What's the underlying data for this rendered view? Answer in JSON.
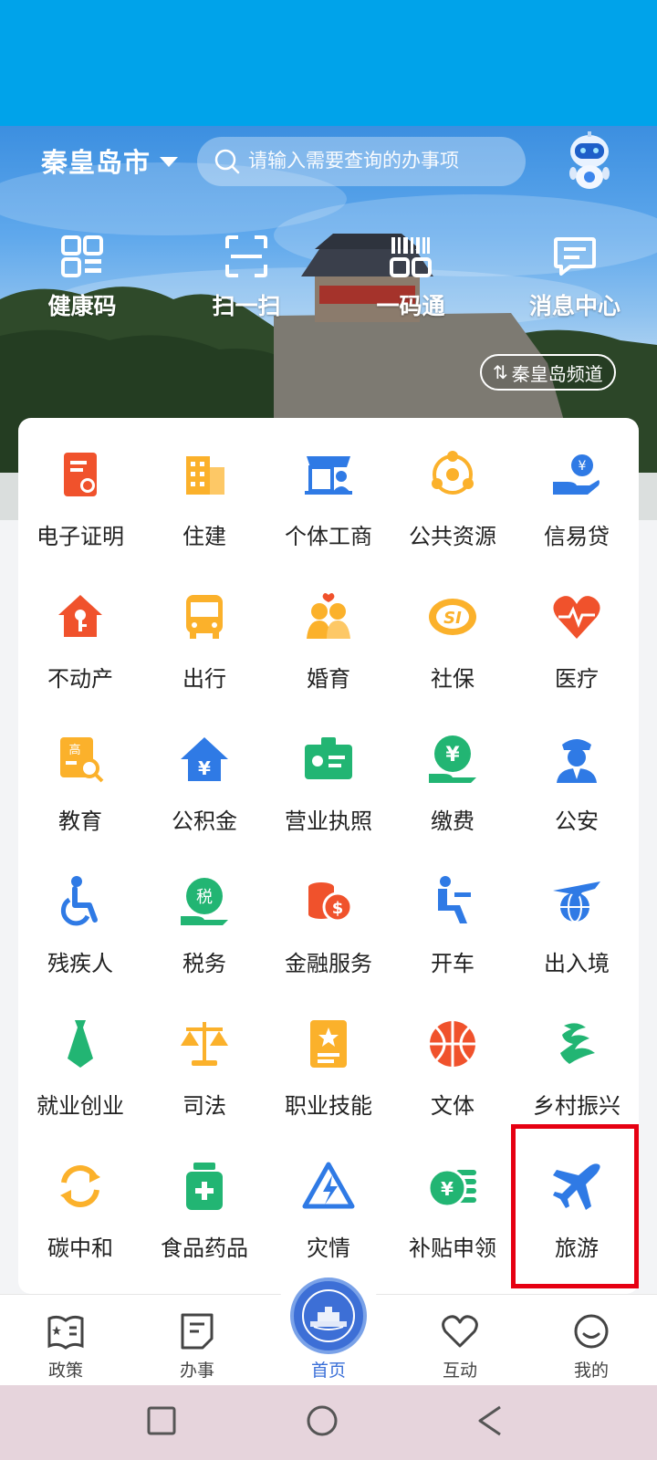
{
  "header": {
    "city": "秦皇岛市",
    "search_placeholder": "请输入需要查询的办事项",
    "channel_label": "秦皇岛频道"
  },
  "quick_actions": [
    {
      "label": "健康码",
      "icon": "qrcode-icon"
    },
    {
      "label": "扫一扫",
      "icon": "scan-icon"
    },
    {
      "label": "一码通",
      "icon": "barcode-icon"
    },
    {
      "label": "消息中心",
      "icon": "message-icon"
    }
  ],
  "services": [
    {
      "label": "电子证明",
      "icon": "certificate-icon",
      "color": "#f0522c"
    },
    {
      "label": "住建",
      "icon": "building-icon",
      "color": "#fbb12b"
    },
    {
      "label": "个体工商",
      "icon": "store-icon",
      "color": "#2f7ae5"
    },
    {
      "label": "公共资源",
      "icon": "resource-network-icon",
      "color": "#fbb12b"
    },
    {
      "label": "信易贷",
      "icon": "loan-hand-icon",
      "color": "#2f7ae5"
    },
    {
      "label": "不动产",
      "icon": "house-key-icon",
      "color": "#f0522c"
    },
    {
      "label": "出行",
      "icon": "bus-icon",
      "color": "#fbb12b"
    },
    {
      "label": "婚育",
      "icon": "couple-icon",
      "color": "#fbb12b"
    },
    {
      "label": "社保",
      "icon": "social-security-icon",
      "color": "#fbb12b"
    },
    {
      "label": "医疗",
      "icon": "heart-pulse-icon",
      "color": "#f0522c"
    },
    {
      "label": "教育",
      "icon": "education-icon",
      "color": "#fbb12b"
    },
    {
      "label": "公积金",
      "icon": "housing-fund-icon",
      "color": "#2f7ae5"
    },
    {
      "label": "营业执照",
      "icon": "business-license-icon",
      "color": "#22b573"
    },
    {
      "label": "缴费",
      "icon": "payment-icon",
      "color": "#22b573"
    },
    {
      "label": "公安",
      "icon": "police-icon",
      "color": "#2f7ae5"
    },
    {
      "label": "残疾人",
      "icon": "wheelchair-icon",
      "color": "#2f7ae5"
    },
    {
      "label": "税务",
      "icon": "tax-icon",
      "color": "#22b573"
    },
    {
      "label": "金融服务",
      "icon": "coins-icon",
      "color": "#f0522c"
    },
    {
      "label": "开车",
      "icon": "driver-seat-icon",
      "color": "#2f7ae5"
    },
    {
      "label": "出入境",
      "icon": "plane-globe-icon",
      "color": "#2f7ae5"
    },
    {
      "label": "就业创业",
      "icon": "tie-icon",
      "color": "#22b573"
    },
    {
      "label": "司法",
      "icon": "scales-icon",
      "color": "#fbb12b"
    },
    {
      "label": "职业技能",
      "icon": "skill-book-icon",
      "color": "#fbb12b"
    },
    {
      "label": "文体",
      "icon": "basketball-icon",
      "color": "#f0522c"
    },
    {
      "label": "乡村振兴",
      "icon": "rural-revival-icon",
      "color": "#22b573"
    },
    {
      "label": "碳中和",
      "icon": "recycle-icon",
      "color": "#fbb12b"
    },
    {
      "label": "食品药品",
      "icon": "medicine-icon",
      "color": "#22b573"
    },
    {
      "label": "灾情",
      "icon": "disaster-icon",
      "color": "#2f7ae5"
    },
    {
      "label": "补贴申领",
      "icon": "subsidy-coins-icon",
      "color": "#22b573"
    },
    {
      "label": "旅游",
      "icon": "airplane-icon",
      "color": "#2f7ae5"
    }
  ],
  "tabs": [
    {
      "label": "政策",
      "icon": "policy-book-icon"
    },
    {
      "label": "办事",
      "icon": "document-icon"
    },
    {
      "label": "首页",
      "icon": "home-emblem-icon",
      "active": true
    },
    {
      "label": "互动",
      "icon": "heart-outline-icon"
    },
    {
      "label": "我的",
      "icon": "smile-icon"
    }
  ],
  "colors": {
    "status_bar": "#00a3ea",
    "accent": "#3a6fd8",
    "highlight": "#e60012"
  }
}
